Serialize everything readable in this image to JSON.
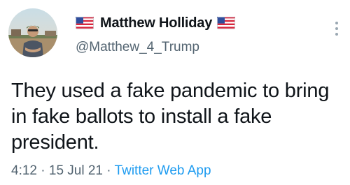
{
  "tweet": {
    "author": {
      "display_name": "Matthew Holliday",
      "handle": "@Matthew_4_Trump",
      "name_prefix_icon": "us-flag-icon",
      "name_suffix_icon": "us-flag-icon"
    },
    "text": "They used a fake pandemic to bring in fake ballots to install a fake president.",
    "time": "4:12",
    "separator": " · ",
    "date": "15 Jul 21",
    "source": "Twitter Web App"
  },
  "colors": {
    "text": "#0f1419",
    "muted": "#536471",
    "link": "#1d9bf0"
  }
}
